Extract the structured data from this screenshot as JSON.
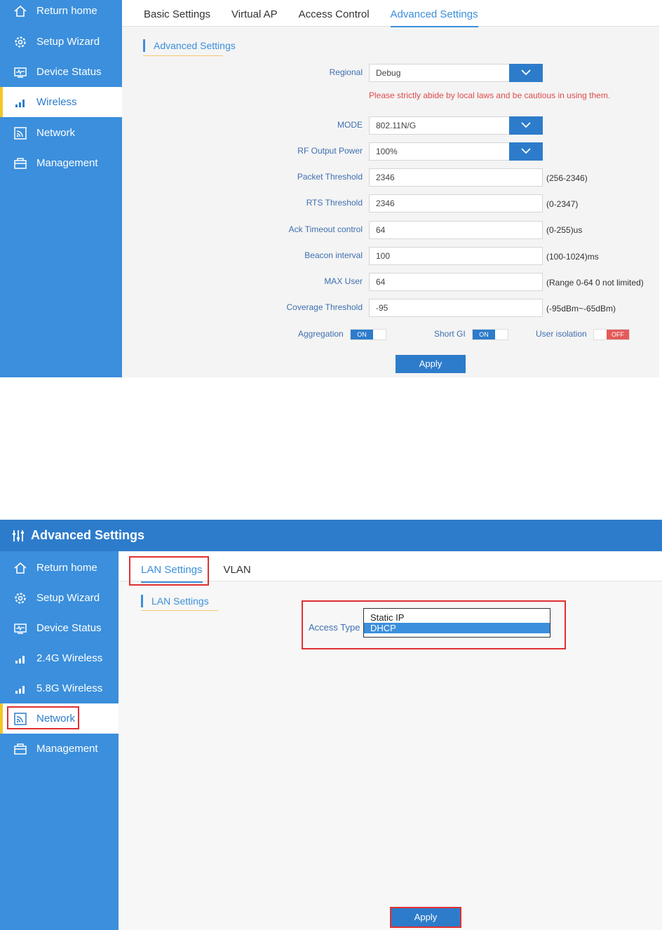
{
  "panel1": {
    "sidebar": [
      {
        "label": "Return home",
        "icon": "home-icon"
      },
      {
        "label": "Setup Wizard",
        "icon": "gear-icon"
      },
      {
        "label": "Device Status",
        "icon": "monitor-icon"
      },
      {
        "label": "Wireless",
        "icon": "signal-icon"
      },
      {
        "label": "Network",
        "icon": "network-icon"
      },
      {
        "label": "Management",
        "icon": "toolbox-icon"
      }
    ],
    "tabs": [
      "Basic Settings",
      "Virtual AP",
      "Access Control",
      "Advanced Settings"
    ],
    "section_title": "Advanced Settings",
    "regional": {
      "label": "Regional",
      "value": "Debug"
    },
    "warning": "Please strictly abide by local laws and be cautious in using them.",
    "mode": {
      "label": "MODE",
      "value": "802.11N/G"
    },
    "rf_power": {
      "label": "RF Output Power",
      "value": "100%"
    },
    "packet_threshold": {
      "label": "Packet Threshold",
      "value": "2346",
      "hint": "(256-2346)"
    },
    "rts_threshold": {
      "label": "RTS Threshold",
      "value": "2346",
      "hint": "(0-2347)"
    },
    "ack_timeout": {
      "label": "Ack Timeout control",
      "value": "64",
      "hint": "(0-255)us"
    },
    "beacon": {
      "label": "Beacon interval",
      "value": "100",
      "hint": "(100-1024)ms"
    },
    "max_user": {
      "label": "MAX User",
      "value": "64",
      "hint": "(Range 0-64 0 not limited)"
    },
    "coverage": {
      "label": "Coverage Threshold",
      "value": "-95",
      "hint": "(-95dBm~-65dBm)"
    },
    "aggregation": {
      "label": "Aggregation",
      "state": "ON"
    },
    "short_gi": {
      "label": "Short GI",
      "state": "ON"
    },
    "user_isolation": {
      "label": "User isolation",
      "state": "OFF"
    },
    "apply": "Apply"
  },
  "panel2": {
    "title": "Advanced Settings",
    "sidebar": [
      {
        "label": "Return home",
        "icon": "home-icon"
      },
      {
        "label": "Setup Wizard",
        "icon": "gear-icon"
      },
      {
        "label": "Device Status",
        "icon": "monitor-icon"
      },
      {
        "label": "2.4G Wireless",
        "icon": "signal-2g-icon"
      },
      {
        "label": "5.8G Wireless",
        "icon": "signal-5g-icon"
      },
      {
        "label": "Network",
        "icon": "network-icon"
      },
      {
        "label": "Management",
        "icon": "toolbox-icon"
      }
    ],
    "tabs": [
      "LAN Settings",
      "VLAN"
    ],
    "section_title": "LAN Settings",
    "access_type": {
      "label": "Access Type",
      "options": [
        "Static IP",
        "DHCP"
      ],
      "selected": "DHCP"
    },
    "apply": "Apply"
  },
  "colors": {
    "accent": "#3b8fdc",
    "highlight": "#e03030",
    "warning": "#e04b4b"
  }
}
